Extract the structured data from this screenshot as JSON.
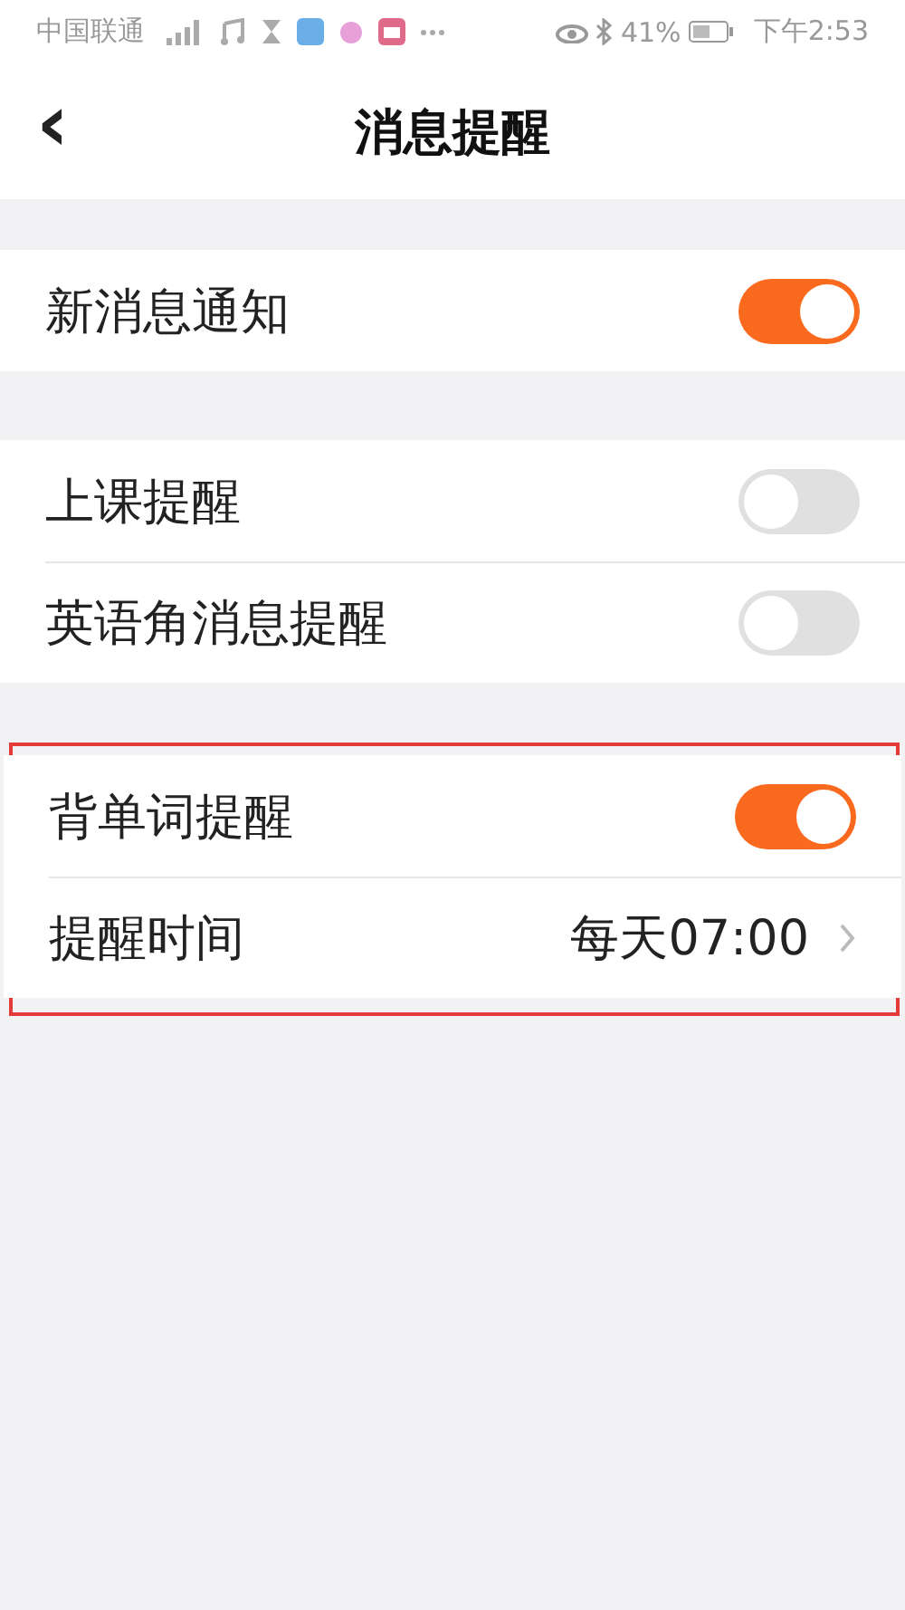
{
  "status_bar": {
    "carrier": "中国联通",
    "battery": "41%",
    "time": "下午2:53"
  },
  "header": {
    "back": "‹",
    "title": "消息提醒"
  },
  "groups": [
    {
      "highlighted": false,
      "rows": [
        {
          "kind": "toggle",
          "label": "新消息通知",
          "on": true
        }
      ]
    },
    {
      "highlighted": false,
      "rows": [
        {
          "kind": "toggle",
          "label": "上课提醒",
          "on": false
        },
        {
          "kind": "toggle",
          "label": "英语角消息提醒",
          "on": false
        }
      ]
    },
    {
      "highlighted": true,
      "rows": [
        {
          "kind": "toggle",
          "label": "背单词提醒",
          "on": true
        },
        {
          "kind": "value",
          "label": "提醒时间",
          "value": "每天07:00"
        }
      ]
    }
  ]
}
